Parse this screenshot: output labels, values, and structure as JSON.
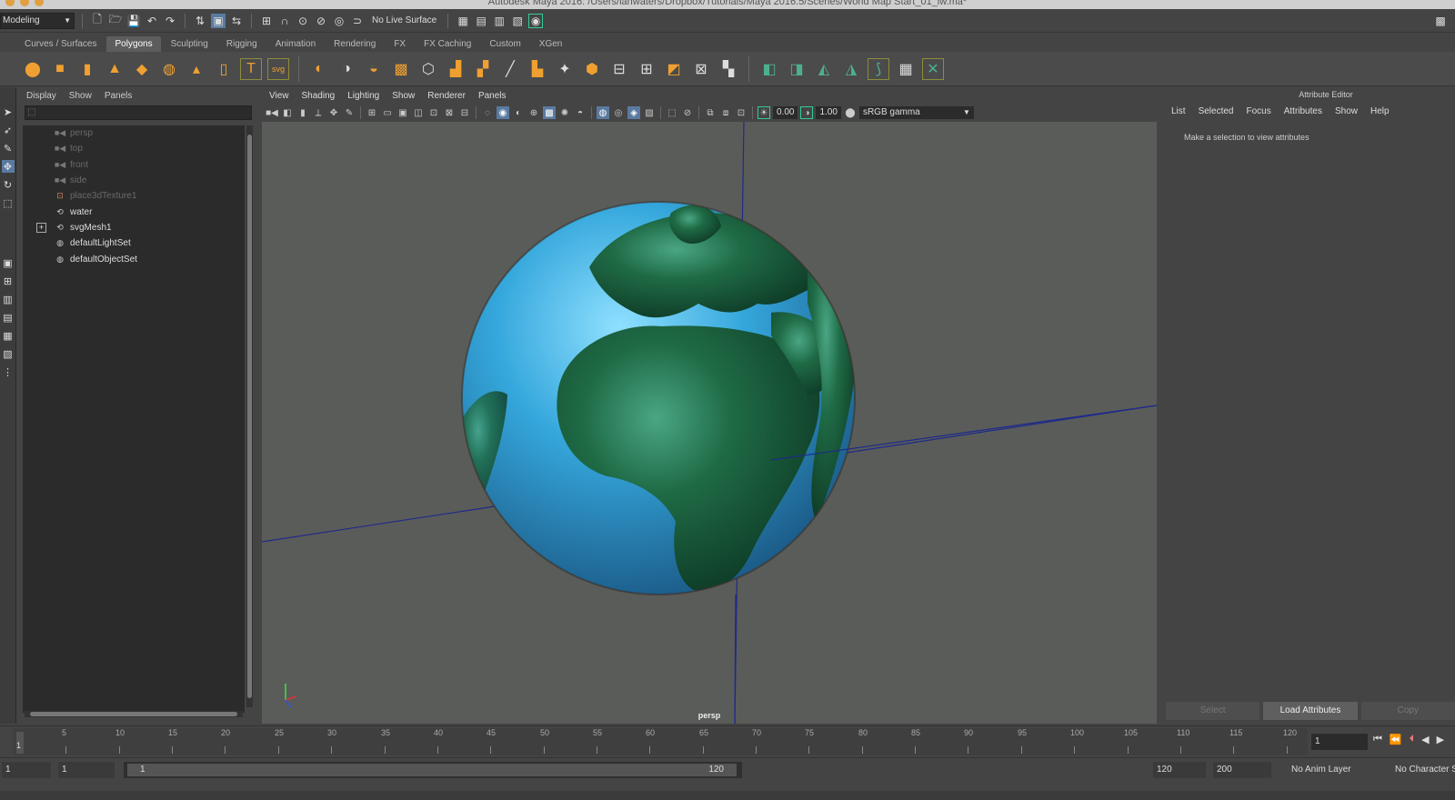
{
  "title_bar": {
    "text": "Autodesk Maya 2016: /Users/ianwaters/Dropbox/Tutorials/Maya 2016.5/Scenes/World Map Start_01_iw.ma*"
  },
  "status_line": {
    "menu_set": "Modeling",
    "live_surface": "No Live Surface"
  },
  "shelf": {
    "tabs": [
      {
        "label": "Curves / Surfaces",
        "active": false
      },
      {
        "label": "Polygons",
        "active": true
      },
      {
        "label": "Sculpting",
        "active": false
      },
      {
        "label": "Rigging",
        "active": false
      },
      {
        "label": "Animation",
        "active": false
      },
      {
        "label": "Rendering",
        "active": false
      },
      {
        "label": "FX",
        "active": false
      },
      {
        "label": "FX Caching",
        "active": false
      },
      {
        "label": "Custom",
        "active": false
      },
      {
        "label": "XGen",
        "active": false
      }
    ],
    "text_tool_label": "T",
    "svg_tool_label": "svg"
  },
  "outliner": {
    "menu": [
      "Display",
      "Show",
      "Panels"
    ],
    "items": [
      {
        "label": "persp",
        "icon": "camera-icon",
        "dim": true,
        "expandable": false
      },
      {
        "label": "top",
        "icon": "camera-icon",
        "dim": true,
        "expandable": false
      },
      {
        "label": "front",
        "icon": "camera-icon",
        "dim": true,
        "expandable": false
      },
      {
        "label": "side",
        "icon": "camera-icon",
        "dim": true,
        "expandable": false
      },
      {
        "label": "place3dTexture1",
        "icon": "texture-placement-icon",
        "dim": true,
        "expandable": false
      },
      {
        "label": "water",
        "icon": "transform-icon",
        "dim": false,
        "expandable": false
      },
      {
        "label": "svgMesh1",
        "icon": "transform-icon",
        "dim": false,
        "expandable": true,
        "expander": "+"
      },
      {
        "label": "defaultLightSet",
        "icon": "set-icon",
        "dim": false,
        "expandable": false
      },
      {
        "label": "defaultObjectSet",
        "icon": "set-icon",
        "dim": false,
        "expandable": false
      }
    ]
  },
  "viewport": {
    "menu": [
      "View",
      "Shading",
      "Lighting",
      "Show",
      "Renderer",
      "Panels"
    ],
    "exposure": "0.00",
    "gamma": "1.00",
    "color_space": "sRGB gamma",
    "camera_label": "persp",
    "colors": {
      "background": "#5a5c59",
      "ocean": "#3aa6d8",
      "land": "#1f6b46",
      "grid_axis": "#1f2a8a"
    }
  },
  "attribute_editor": {
    "title": "Attribute Editor",
    "menu": [
      "List",
      "Selected",
      "Focus",
      "Attributes",
      "Show",
      "Help"
    ],
    "message": "Make a selection to view attributes",
    "buttons": [
      {
        "label": "Select",
        "active": false
      },
      {
        "label": "Load Attributes",
        "active": true
      },
      {
        "label": "Copy",
        "active": false
      }
    ]
  },
  "time_slider": {
    "marks": [
      "5",
      "10",
      "15",
      "20",
      "25",
      "30",
      "35",
      "40",
      "45",
      "50",
      "55",
      "60",
      "65",
      "70",
      "75",
      "80",
      "85",
      "90",
      "95",
      "100",
      "105",
      "110",
      "115",
      "120"
    ],
    "current_frame_marker": "1",
    "current_frame_field": "1"
  },
  "range_slider": {
    "start_time": "1",
    "playback_start": "1",
    "thumb_start": "1",
    "thumb_end": "120",
    "playback_end": "120",
    "end_time": "200",
    "anim_layer": "No Anim Layer",
    "character_set": "No Character Set"
  }
}
